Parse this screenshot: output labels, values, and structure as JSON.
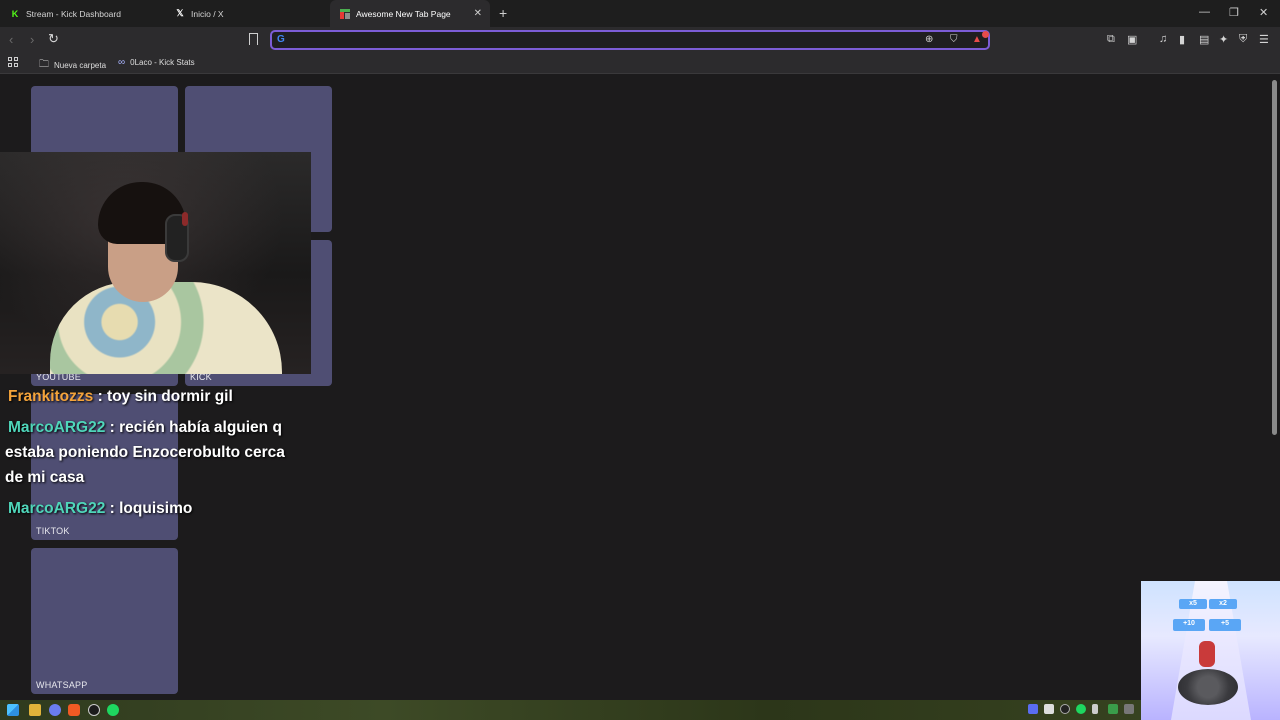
{
  "tabs": [
    {
      "label": "Stream - Kick Dashboard",
      "icon": "kick-icon"
    },
    {
      "label": "Inicio / X",
      "icon": "x-icon"
    },
    {
      "label": "Awesome New Tab Page",
      "icon": "newtab-icon",
      "active": true
    }
  ],
  "omnibox": {
    "value": "",
    "placeholder": ""
  },
  "bookmarks": [
    {
      "label": "Nueva carpeta",
      "icon": "folder-icon"
    },
    {
      "label": "0Laco - Kick Stats",
      "icon": "kickstats-icon"
    }
  ],
  "tiles": {
    "youtube": "YOUTUBE",
    "kick": "KICK",
    "tiktok": "TIKTOK",
    "whatsapp": "WHATSAPP"
  },
  "chat": [
    {
      "user": "Frankitozzs",
      "text": ": toy sin dormir gil",
      "color": "#f4a33a"
    },
    {
      "user": "MarcoARG22",
      "text": ": recién había alguien q estaba poniendo Enzocerobulto cerca de mi casa",
      "color": "#4fd6ba"
    },
    {
      "user": "MarcoARG22",
      "text": ": loquisimo",
      "color": "#4fd6ba"
    }
  ],
  "game": {
    "gate_top_left": "x5",
    "gate_top_right": "x2",
    "gate_bottom_left": "+10",
    "gate_bottom_right": "+5"
  },
  "colors": {
    "accent": "#7c5cd6",
    "tile": "#4f4e73",
    "page_bg": "#1c1b1c"
  }
}
